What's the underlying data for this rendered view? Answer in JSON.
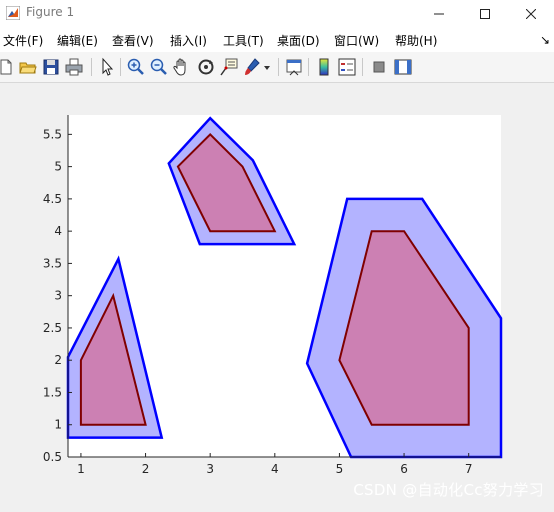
{
  "window": {
    "title": "Figure 1",
    "minimize_icon": "minimize-icon",
    "maximize_icon": "maximize-icon",
    "close_icon": "close-icon"
  },
  "menu": {
    "items": [
      "文件(F)",
      "编辑(E)",
      "查看(V)",
      "插入(I)",
      "工具(T)",
      "桌面(D)",
      "窗口(W)",
      "帮助(H)"
    ],
    "overflow_icon": "dock-arrow-icon"
  },
  "toolbar": {
    "icons": [
      "new-figure-icon",
      "open-file-icon",
      "save-icon",
      "print-icon",
      "pointer-icon",
      "zoom-in-icon",
      "zoom-out-icon",
      "pan-hand-icon",
      "rotate-3d-icon",
      "data-cursor-icon",
      "brush-icon",
      "brush-dropdown-icon",
      "link-plot-icon",
      "colorbar-icon",
      "legend-icon",
      "hide-plot-tools-icon",
      "show-plot-tools-icon"
    ]
  },
  "chart_data": {
    "type": "polygon",
    "title": "",
    "xlabel": "",
    "ylabel": "",
    "xlim": [
      0.8,
      7.5
    ],
    "ylim": [
      0.5,
      5.8
    ],
    "xticks": [
      "1",
      "2",
      "3",
      "4",
      "5",
      "6",
      "7"
    ],
    "xtick_values": [
      1,
      2,
      3,
      4,
      5,
      6,
      7
    ],
    "yticks": [
      "0.5",
      "1",
      "1.5",
      "2",
      "2.5",
      "3",
      "3.5",
      "4",
      "4.5",
      "5",
      "5.5"
    ],
    "ytick_values": [
      0.5,
      1,
      1.5,
      2,
      2.5,
      3,
      3.5,
      4,
      4.5,
      5,
      5.5
    ],
    "grid": false,
    "series": [
      {
        "role": "outer",
        "face_color": "#b3b3ff",
        "edge_color": "#0000ff",
        "points": [
          [
            0.8,
            0.8
          ],
          [
            2.25,
            0.8
          ],
          [
            1.58,
            3.57
          ],
          [
            0.8,
            2.05
          ]
        ]
      },
      {
        "role": "inner",
        "face_color": "#cc80b3",
        "edge_color": "#800000",
        "points": [
          [
            1,
            1
          ],
          [
            2,
            1
          ],
          [
            1.5,
            3
          ],
          [
            1,
            2
          ]
        ]
      },
      {
        "role": "outer",
        "face_color": "#b3b3ff",
        "edge_color": "#0000ff",
        "points": [
          [
            2.84,
            3.8
          ],
          [
            4.3,
            3.8
          ],
          [
            3.66,
            5.1
          ],
          [
            3,
            5.75
          ],
          [
            2.36,
            5.05
          ]
        ]
      },
      {
        "role": "inner",
        "face_color": "#cc80b3",
        "edge_color": "#800000",
        "points": [
          [
            3,
            4
          ],
          [
            4,
            4
          ],
          [
            3.5,
            5
          ],
          [
            3,
            5.5
          ],
          [
            2.5,
            5
          ]
        ]
      },
      {
        "role": "outer",
        "face_color": "#b3b3ff",
        "edge_color": "#0000ff",
        "points": [
          [
            5.18,
            0.5
          ],
          [
            7.5,
            0.5
          ],
          [
            7.5,
            2.65
          ],
          [
            6.28,
            4.5
          ],
          [
            5.12,
            4.5
          ],
          [
            4.5,
            1.95
          ]
        ]
      },
      {
        "role": "inner",
        "face_color": "#cc80b3",
        "edge_color": "#800000",
        "points": [
          [
            5.5,
            1
          ],
          [
            7,
            1
          ],
          [
            7,
            2.5
          ],
          [
            6,
            4
          ],
          [
            5.5,
            4
          ],
          [
            5,
            2
          ]
        ]
      }
    ]
  },
  "watermark": "CSDN @自动化Cc努力学习"
}
